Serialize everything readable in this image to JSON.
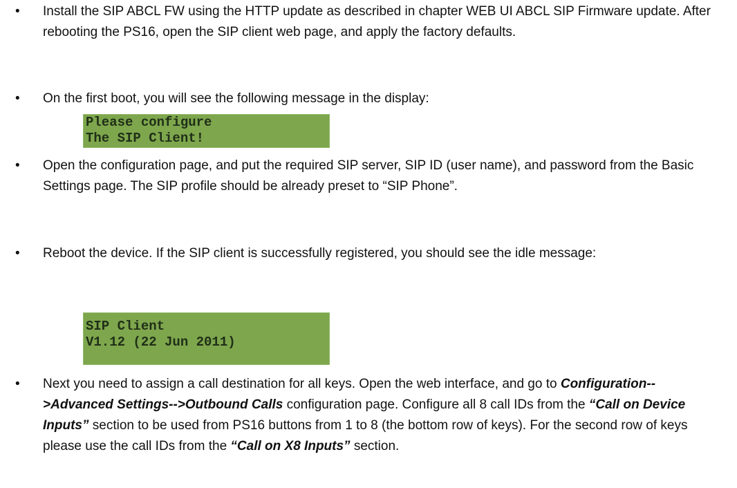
{
  "bullets": [
    {
      "marker": "•",
      "text": "Install the SIP ABCL FW using the HTTP update as described in chapter WEB UI ABCL SIP Firmware update. After rebooting the PS16, open the SIP client web page, and apply the factory defaults."
    },
    {
      "marker": "•",
      "text": "On the first boot, you will see the following message in the display:"
    },
    {
      "marker": "•",
      "text": "Open the configuration page, and put the required SIP server, SIP ID (user name), and password from the Basic Settings page. The SIP profile should be already preset to “SIP Phone”."
    },
    {
      "marker": "•",
      "text": "Reboot the device. If the SIP client is successfully registered, you should see the idle message:"
    },
    {
      "marker": "•",
      "parts": [
        "Next you need to assign a call destination for all keys. Open the web interface, and go to ",
        "Configuration-->Advanced Settings-->Outbound Calls",
        " configuration page. Configure all 8 call IDs from the ",
        "“Call on Device Inputs”",
        " section to be used from PS16 buttons from 1 to 8 (the bottom row of keys). For the second row of keys please use the call IDs from the ",
        "“Call on X8 Inputs”",
        " section."
      ]
    }
  ],
  "displays": {
    "first_boot": {
      "line1": "Please configure",
      "line2": "The SIP Client!"
    },
    "idle": {
      "line1": "SIP Client",
      "line2": "V1.12 (22 Jun 2011)"
    }
  },
  "colors": {
    "lcd_background": "#7ea64d",
    "lcd_text": "#1f2f17",
    "text": "#111111"
  }
}
